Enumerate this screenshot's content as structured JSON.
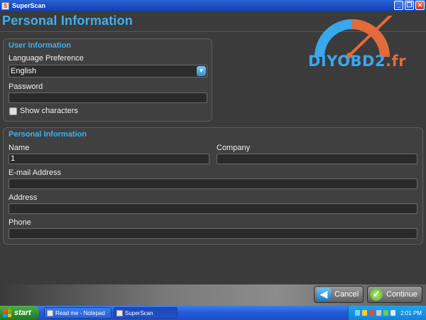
{
  "window": {
    "title": "SuperScan",
    "controls": [
      "minimize-icon",
      "restore-icon",
      "close-icon"
    ]
  },
  "page": {
    "title": "Personal Information"
  },
  "logo": {
    "text_main": "DIYOBD2",
    "text_suffix": ".fr"
  },
  "user_info": {
    "group_title": "User Information",
    "language_label": "Language Preference",
    "language_value": "English",
    "password_label": "Password",
    "password_value": "",
    "show_characters_label": "Show characters",
    "show_characters_checked": false
  },
  "personal_info": {
    "group_title": "Personal Information",
    "name_label": "Name",
    "name_value": "1",
    "company_label": "Company",
    "company_value": "",
    "email_label": "E-mail Address",
    "email_value": "",
    "address_label": "Address",
    "address_value": "",
    "phone_label": "Phone",
    "phone_value": ""
  },
  "buttons": {
    "cancel_label": "Cancel",
    "continue_label": "Continue"
  },
  "taskbar": {
    "start_label": "start",
    "items": [
      {
        "label": "Read me - Notepad",
        "active": false
      },
      {
        "label": "SuperScan",
        "active": true
      }
    ],
    "clock": "2:01 PM"
  },
  "colors": {
    "accent": "#3fb0ee",
    "background": "#3b3b3b",
    "logo_orange": "#e36a3a"
  }
}
